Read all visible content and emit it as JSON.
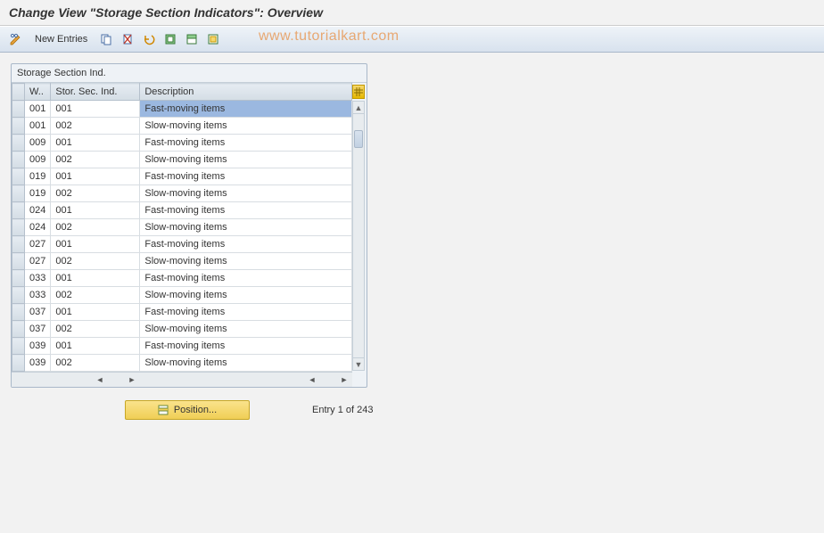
{
  "title": "Change View \"Storage Section Indicators\": Overview",
  "toolbar": {
    "new_entries_label": "New Entries"
  },
  "watermark": "www.tutorialkart.com",
  "panel": {
    "header": "Storage Section Ind.",
    "columns": {
      "c0": "W..",
      "c1": "Stor. Sec. Ind.",
      "c2": "Description"
    }
  },
  "rows": [
    {
      "w": "001",
      "ind": "001",
      "desc": "Fast-moving items",
      "selected": true
    },
    {
      "w": "001",
      "ind": "002",
      "desc": "Slow-moving items"
    },
    {
      "w": "009",
      "ind": "001",
      "desc": "Fast-moving items"
    },
    {
      "w": "009",
      "ind": "002",
      "desc": "Slow-moving items"
    },
    {
      "w": "019",
      "ind": "001",
      "desc": "Fast-moving items"
    },
    {
      "w": "019",
      "ind": "002",
      "desc": "Slow-moving items"
    },
    {
      "w": "024",
      "ind": "001",
      "desc": "Fast-moving items"
    },
    {
      "w": "024",
      "ind": "002",
      "desc": "Slow-moving items"
    },
    {
      "w": "027",
      "ind": "001",
      "desc": "Fast-moving items"
    },
    {
      "w": "027",
      "ind": "002",
      "desc": "Slow-moving items"
    },
    {
      "w": "033",
      "ind": "001",
      "desc": "Fast-moving items"
    },
    {
      "w": "033",
      "ind": "002",
      "desc": "Slow-moving items"
    },
    {
      "w": "037",
      "ind": "001",
      "desc": "Fast-moving items"
    },
    {
      "w": "037",
      "ind": "002",
      "desc": "Slow-moving items"
    },
    {
      "w": "039",
      "ind": "001",
      "desc": "Fast-moving items"
    },
    {
      "w": "039",
      "ind": "002",
      "desc": "Slow-moving items"
    }
  ],
  "footer": {
    "position_label": "Position...",
    "entry_text": "Entry 1 of 243"
  }
}
